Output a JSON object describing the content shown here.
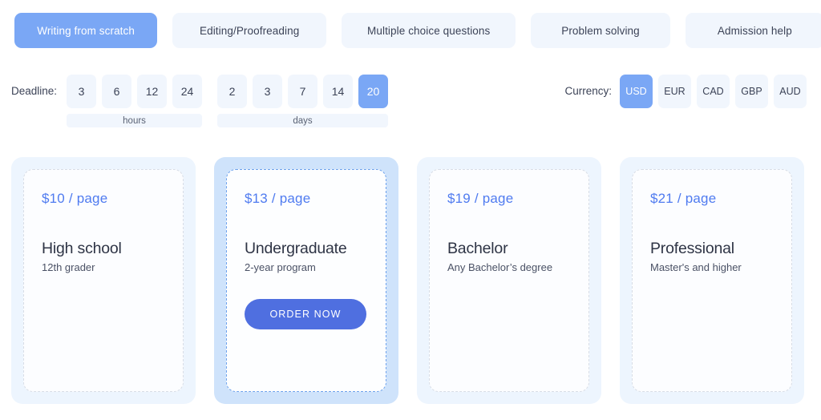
{
  "tabs": [
    {
      "label": "Writing from scratch",
      "active": true
    },
    {
      "label": "Editing/Proofreading",
      "active": false
    },
    {
      "label": "Multiple choice questions",
      "active": false
    },
    {
      "label": "Problem solving",
      "active": false
    },
    {
      "label": "Admission help",
      "active": false
    }
  ],
  "deadline": {
    "label": "Deadline:",
    "groups": [
      {
        "unit": "hours",
        "options": [
          "3",
          "6",
          "12",
          "24"
        ],
        "selected": null
      },
      {
        "unit": "days",
        "options": [
          "2",
          "3",
          "7",
          "14",
          "20"
        ],
        "selected": "20"
      }
    ]
  },
  "currency": {
    "label": "Currency:",
    "options": [
      "USD",
      "EUR",
      "CAD",
      "GBP",
      "AUD"
    ],
    "selected": "USD"
  },
  "cards": [
    {
      "price": "$10 / page",
      "title": "High school",
      "subtitle": "12th grader",
      "selected": false,
      "cta": null
    },
    {
      "price": "$13 / page",
      "title": "Undergraduate",
      "subtitle": "2-year program",
      "selected": true,
      "cta": "ORDER NOW"
    },
    {
      "price": "$19 / page",
      "title": "Bachelor",
      "subtitle": "Any Bachelor’s degree",
      "selected": false,
      "cta": null
    },
    {
      "price": "$21 / page",
      "title": "Professional",
      "subtitle": "Master's and higher",
      "selected": false,
      "cta": null
    }
  ],
  "colors": {
    "accent": "#7aa7f5",
    "accent_strong": "#4f6fe0",
    "price": "#4f7bf0",
    "chip_bg": "#f1f6fd",
    "card_bg": "#edf5fe",
    "card_bg_selected": "#cfe3fb",
    "text_dark": "#2e3445",
    "page_bg": "#ffffff"
  }
}
